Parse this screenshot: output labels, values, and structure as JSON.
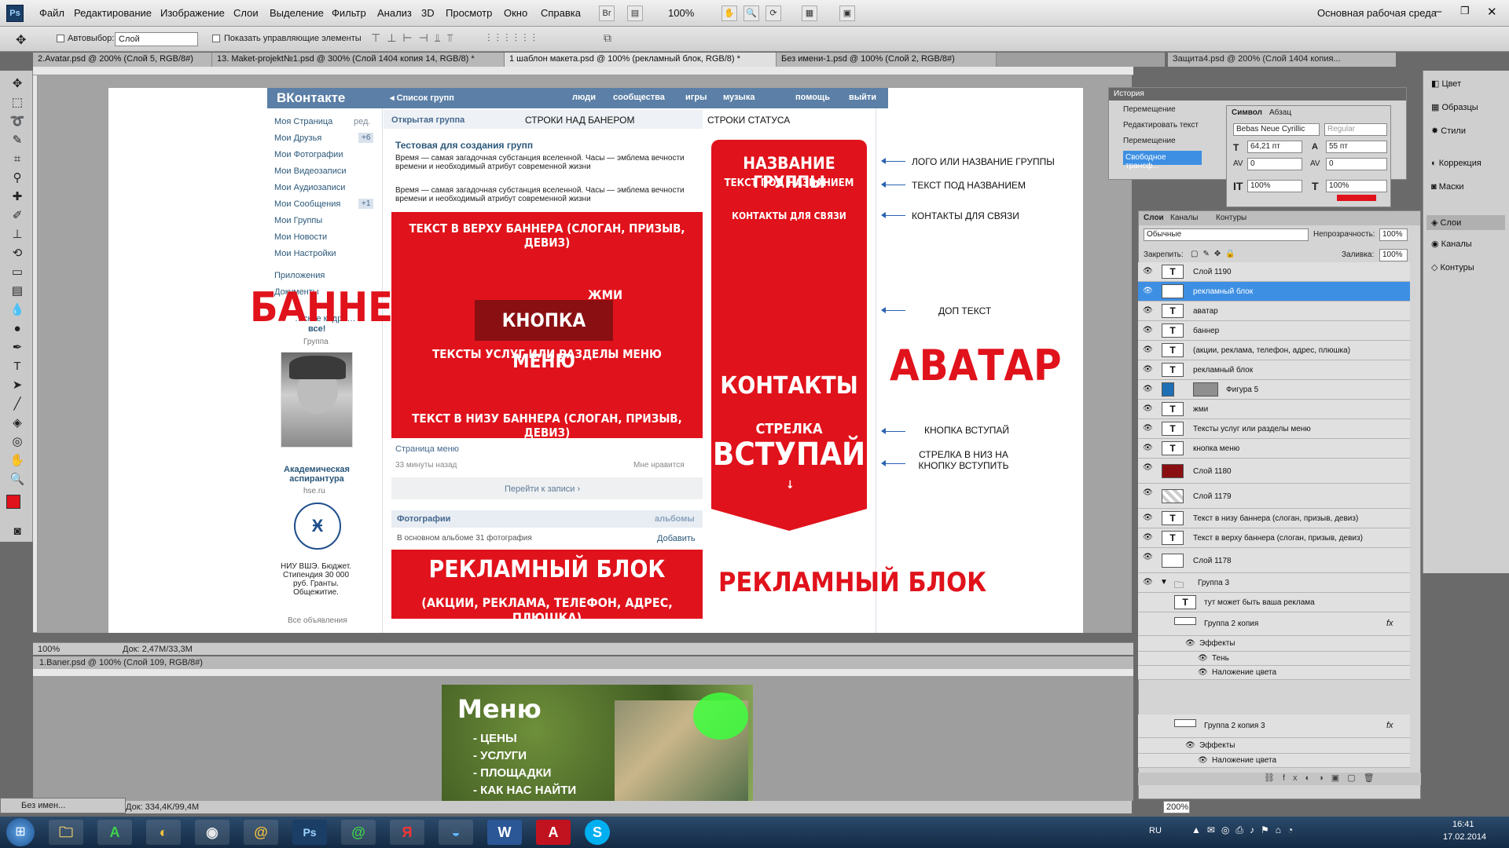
{
  "menubar": {
    "items": [
      "Файл",
      "Редактирование",
      "Изображение",
      "Слои",
      "Выделение",
      "Фильтр",
      "Анализ",
      "3D",
      "Просмотр",
      "Окно",
      "Справка"
    ],
    "zoom": "100%",
    "workspace": "Основная рабочая среда"
  },
  "options": {
    "autoselect": "Автовыбор:",
    "autoselect_value": "Слой",
    "show_controls": "Показать управляющие элементы"
  },
  "tabs": [
    "2.Avatar.psd @ 200% (Слой 5, RGB/8#)",
    "13. Maket-projekt№1.psd @ 300% (Слой 1404 копия 14, RGB/8) *",
    "1 шаблон макета.psd @ 100% (рекламный блок, RGB/8) *",
    "Без имени-1.psd @ 100% (Слой 2, RGB/8#)",
    "Защита4.psd @ 200% (Слой 1404 копия..."
  ],
  "vk": {
    "logo": "ВКонтакте",
    "back": "◂ Список групп",
    "nav": [
      "люди",
      "сообщества",
      "игры",
      "музыка",
      "помощь",
      "выйти"
    ],
    "left_menu": [
      "Моя Страница",
      "Мои Друзья",
      "Мои Фотографии",
      "Мои Видеозаписи",
      "Мои Аудиозаписи",
      "Мои Сообщения",
      "Мои Группы",
      "Мои Новости",
      "Мои Настройки"
    ],
    "edit": "ред.",
    "friends_badge": "+6",
    "msg_badge": "+1",
    "apps": "Приложения",
    "docs": "Документы",
    "promo_title": "…ские кадро…",
    "promo_sub": "все!",
    "group_label": "Группа",
    "ad_title": "Академическая аспирантура",
    "ad_site": "hse.ru",
    "ad_text": "НИУ ВШЭ. Бюджет. Стипендия 30 000 руб. Гранты. Общежитие.",
    "all_ads": "Все объявления",
    "open_group": "Открытая группа",
    "group_title": "Тестовая для создания групп",
    "status1": "Время — самая загадочная субстанция вселенной. Часы — эмблема вечности времени и необходимый атрибут современной жизни",
    "status2": "Время — самая загадочная субстанция вселенной. Часы — эмблема вечности времени и необходимый атрибут современной жизни",
    "page_menu": "Страница меню",
    "time_ago": "33 минуты назад",
    "like": "Мне нравится",
    "goto": "Перейти к записи ›",
    "photos": "Фотографии",
    "albums": "альбомы",
    "main_album": "В основном альбоме 31 фотография",
    "add": "Добавить"
  },
  "banner": {
    "top": "ТЕКСТ В ВЕРХУ БАННЕРА (СЛОГАН, ПРИЗЫВ, ДЕВИЗ)",
    "btn": "КНОПКА МЕНЮ",
    "jmi": "ЖМИ",
    "services": "ТЕКСТЫ УСЛУГ ИЛИ РАЗДЕЛЫ МЕНЮ",
    "bottom": "ТЕКСТ В НИЗУ БАННЕРА (СЛОГАН, ПРИЗЫВ, ДЕВИЗ)"
  },
  "adblock": {
    "title": "РЕКЛАМНЫЙ БЛОК",
    "sub": "(АКЦИИ, РЕКЛАМА, ТЕЛЕФОН, АДРЕС, ПЛЮШКА)"
  },
  "avatar": {
    "name": "НАЗВАНИЕ ГРУППЫ",
    "under": "ТЕКСТ ПОД НАЗВАНИЕМ",
    "contacts_small": "КОНТАКТЫ ДЛЯ СВЯЗИ",
    "contacts": "КОНТАКТЫ",
    "arrow": "СТРЕЛКА",
    "join": "ВСТУПАЙ"
  },
  "labels": {
    "banner": "БАННЕР",
    "avatar": "АВАТАР",
    "adblock": "РЕКЛАМНЫЙ БЛОК",
    "above_banner": "СТРОКИ НАД БАНЕРОМ",
    "status_lines": "СТРОКИ СТАТУСА",
    "logo": "ЛОГО ИЛИ НАЗВАНИЕ ГРУППЫ",
    "under_name": "ТЕКСТ ПОД НАЗВАНИЕМ",
    "contacts": "КОНТАКТЫ ДЛЯ СВЯЗИ",
    "extra": "ДОП ТЕКСТ",
    "join_btn": "КНОПКА ВСТУПАЙ",
    "arrow_down": "СТРЕЛКА В НИЗ НА КНОПКУ ВСТУПИТЬ"
  },
  "status": {
    "zoom": "100%",
    "doc": "Док: 2,47M/33,3M",
    "zoom2": "200%",
    "doc2": "Док: 334,4K/99,4M"
  },
  "history": {
    "title": "История",
    "items": [
      "Перемещение",
      "Редактировать текст",
      "Перемещение",
      "Свободное трансф..."
    ]
  },
  "character": {
    "tab1": "Символ",
    "tab2": "Абзац",
    "font": "Bebas Neue Cyrillic",
    "style": "Regular",
    "size": "64,21 пт",
    "leading": "55 пт",
    "tracking": "0",
    "kerning": "0",
    "vscale": "100%",
    "hscale": "100%"
  },
  "layers": {
    "tabs": [
      "Слои",
      "Каналы",
      "Контуры"
    ],
    "blend": "Обычные",
    "opacity_label": "Непрозрачность:",
    "opacity": "100%",
    "lock": "Закрепить:",
    "fill_label": "Заливка:",
    "fill": "100%",
    "items": [
      {
        "name": "Слой 1190",
        "type": "T"
      },
      {
        "name": "рекламный блок",
        "type": "T",
        "selected": true
      },
      {
        "name": "аватар",
        "type": "T"
      },
      {
        "name": "баннер",
        "type": "T"
      },
      {
        "name": "(акции, реклама, телефон, адрес, плюшка)",
        "type": "T"
      },
      {
        "name": "рекламный блок",
        "type": "T"
      },
      {
        "name": "Фигура 5",
        "type": "S"
      },
      {
        "name": "жми",
        "type": "T"
      },
      {
        "name": "Тексты услуг или разделы меню",
        "type": "T"
      },
      {
        "name": "кнопка меню",
        "type": "T"
      },
      {
        "name": "Слой 1180",
        "type": "R"
      },
      {
        "name": "Слой 1179",
        "type": "C"
      },
      {
        "name": "Текст в низу баннера (слоган, призыв, девиз)",
        "type": "T"
      },
      {
        "name": "Текст в верху баннера (слоган, призыв, девиз)",
        "type": "T"
      },
      {
        "name": "Слой 1178",
        "type": "W"
      },
      {
        "name": "Группа 3",
        "type": "G"
      },
      {
        "name": "тут может быть ваша            реклама",
        "type": "T"
      },
      {
        "name": "Группа 2 копия",
        "type": "F"
      },
      {
        "name": "Эффекты",
        "type": "E"
      },
      {
        "name": "Тень",
        "type": "E2"
      },
      {
        "name": "Наложение цвета",
        "type": "E2"
      },
      {
        "name": "Группа 2 копия 3",
        "type": "F"
      },
      {
        "name": "Эффекты",
        "type": "E"
      },
      {
        "name": "Наложение цвета",
        "type": "E2"
      }
    ]
  },
  "dock": [
    "Цвет",
    "Образцы",
    "Стили",
    "Коррекция",
    "Маски",
    "Слои",
    "Каналы",
    "Контуры"
  ],
  "doc2": {
    "tab": "1.Baner.psd @ 100% (Слой 109, RGB/8#)",
    "menu": "Меню",
    "items": [
      "- ЦЕНЫ",
      "- УСЛУГИ",
      "- ПЛОЩАДКИ",
      "- КАК НАС НАЙТИ"
    ],
    "minimized": "Без имен..."
  },
  "tray": {
    "lang": "RU",
    "time": "16:41",
    "date": "17.02.2014"
  }
}
